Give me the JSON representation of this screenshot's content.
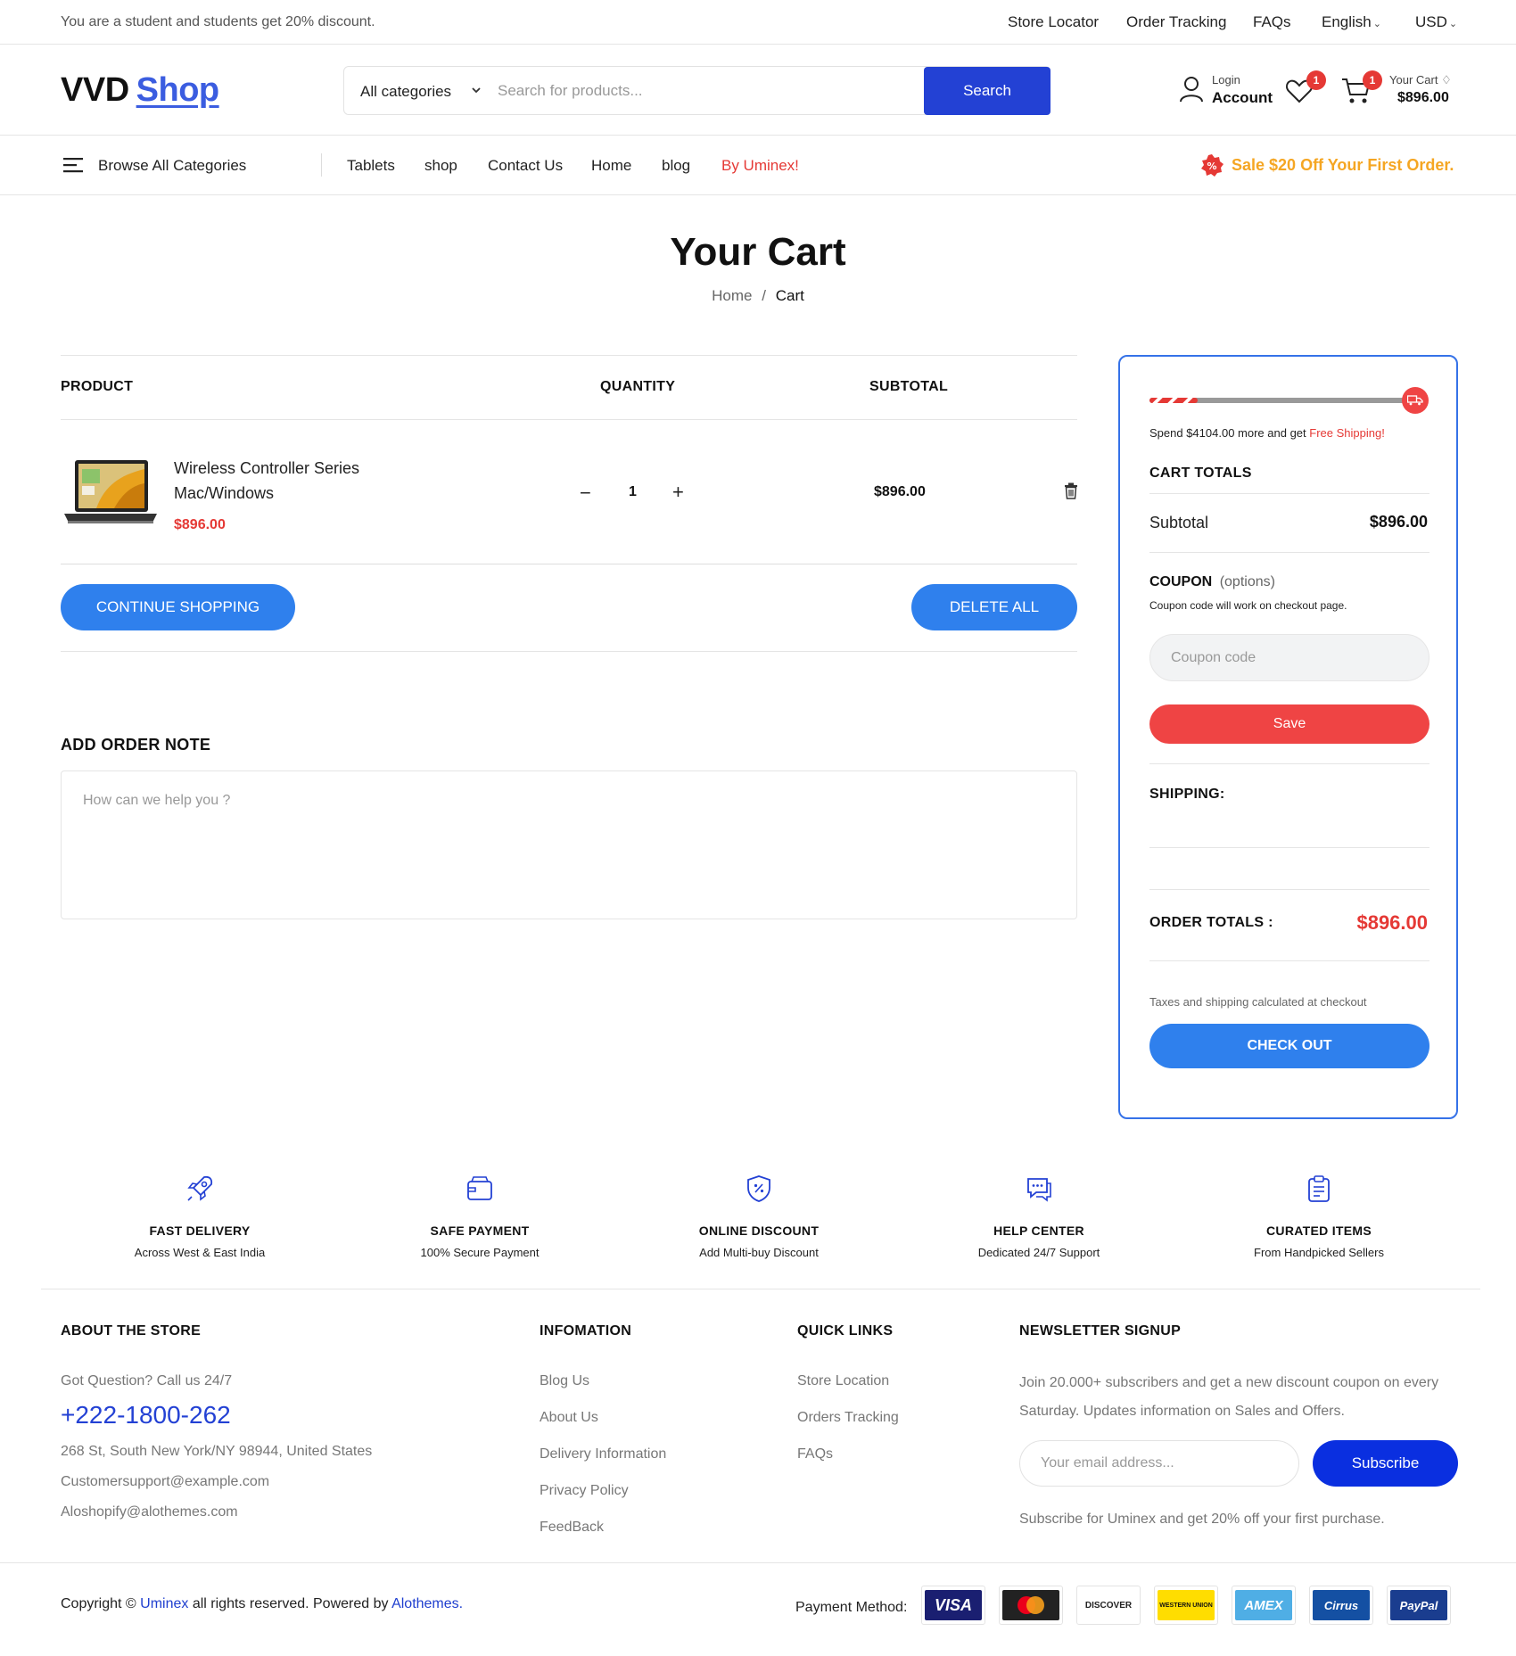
{
  "topbar": {
    "promo": "You are a student and students get 20% discount.",
    "links": [
      "Store Locator",
      "Order Tracking",
      "FAQs"
    ],
    "language": "English",
    "currency": "USD"
  },
  "header": {
    "logo_main": "VVD",
    "logo_accent": "Shop",
    "category_select": "All categories",
    "search_placeholder": "Search for products...",
    "search_button": "Search",
    "account_small": "Login",
    "account_big": "Account",
    "wishlist_count": "1",
    "cart_count": "1",
    "cart_label": "Your Cart",
    "cart_total": "$896.00"
  },
  "nav": {
    "browse": "Browse All Categories",
    "items": [
      "Tablets",
      "shop",
      "Contact Us",
      "Home",
      "blog"
    ],
    "highlight": "By Uminex!",
    "sale": "Sale $20 Off Your First Order."
  },
  "page": {
    "title": "Your Cart",
    "breadcrumb_home": "Home",
    "breadcrumb_sep": "/",
    "breadcrumb_current": "Cart"
  },
  "cart": {
    "headers": {
      "product": "PRODUCT",
      "quantity": "QUANTITY",
      "subtotal": "SUBTOTAL"
    },
    "item": {
      "name_line1": "Wireless Controller Series",
      "name_line2": "Mac/Windows",
      "price": "$896.00",
      "quantity": "1",
      "subtotal": "$896.00"
    },
    "continue_button": "CONTINUE SHOPPING",
    "delete_all_button": "DELETE ALL"
  },
  "order_note": {
    "title": "ADD ORDER NOTE",
    "placeholder": "How can we help you ?"
  },
  "summary": {
    "shipping_progress": 0.18,
    "spend_prefix": "Spend $4104.00 more and get ",
    "spend_link": "Free Shipping!",
    "totals_title": "CART TOTALS",
    "subtotal_label": "Subtotal",
    "subtotal_value": "$896.00",
    "coupon_title": "COUPON",
    "coupon_options": "(options)",
    "coupon_note": "Coupon code will work on checkout page.",
    "coupon_placeholder": "Coupon code",
    "save_button": "Save",
    "shipping_label": "SHIPPING:",
    "order_totals_label": "ORDER TOTALS :",
    "order_totals_value": "$896.00",
    "tax_note": "Taxes and shipping calculated at checkout",
    "checkout_button": "CHECK OUT"
  },
  "features": [
    {
      "icon": "rocket-icon",
      "title": "FAST DELIVERY",
      "sub": "Across West & East India"
    },
    {
      "icon": "wallet-icon",
      "title": "SAFE PAYMENT",
      "sub": "100% Secure Payment"
    },
    {
      "icon": "shield-discount-icon",
      "title": "ONLINE DISCOUNT",
      "sub": "Add Multi-buy Discount"
    },
    {
      "icon": "chat-icon",
      "title": "HELP CENTER",
      "sub": "Dedicated 24/7 Support"
    },
    {
      "icon": "clipboard-icon",
      "title": "CURATED ITEMS",
      "sub": "From Handpicked Sellers"
    }
  ],
  "footer": {
    "about_title": "ABOUT THE STORE",
    "call_text": "Got Question? Call us 24/7",
    "phone": "+222-1800-262",
    "address": "268 St, South New York/NY 98944, United States",
    "email1": "Customersupport@example.com",
    "email2": "Aloshopify@alothemes.com",
    "info_title": "INFOMATION",
    "info_links": [
      "Blog Us",
      "About Us",
      "Delivery Information",
      "Privacy Policy",
      "FeedBack"
    ],
    "quick_title": "QUICK LINKS",
    "quick_links": [
      "Store Location",
      "Orders Tracking",
      "FAQs"
    ],
    "newsletter_title": "NEWSLETTER SIGNUP",
    "newsletter_line1": "Join 20.000+ subscribers and get a new discount coupon on every",
    "newsletter_line2": "Saturday. Updates information on Sales and Offers.",
    "email_placeholder": "Your email address...",
    "subscribe_button": "Subscribe",
    "subscribe_note": "Subscribe for Uminex and get 20% off your first purchase.",
    "copyright_prefix": "Copyright © ",
    "copyright_brand": "Uminex",
    "copyright_mid": " all rights reserved. Powered by ",
    "copyright_link": "Alothemes.",
    "payment_label": "Payment Method:",
    "payment_cards": [
      "VISA",
      "MasterCard",
      "DISCOVER",
      "WESTERN UNION",
      "AMEX",
      "Cirrus",
      "PayPal"
    ]
  },
  "colors": {
    "primary_blue": "#2f80ed",
    "dark_blue": "#2341d4",
    "red": "#ef4444",
    "sale_orange": "#f5a623"
  }
}
